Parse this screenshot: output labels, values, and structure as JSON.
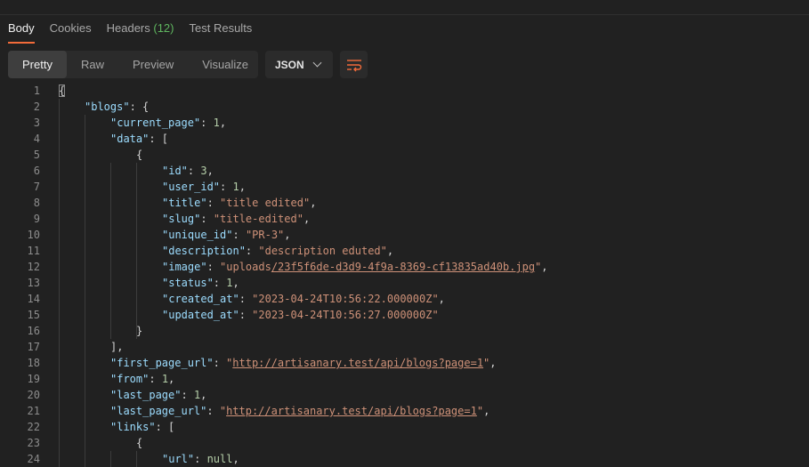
{
  "tabs": [
    {
      "label": "Body"
    },
    {
      "label": "Cookies"
    },
    {
      "label": "Headers",
      "count": "(12)"
    },
    {
      "label": "Test Results"
    }
  ],
  "view_modes": [
    "Pretty",
    "Raw",
    "Preview",
    "Visualize"
  ],
  "format": "JSON",
  "icons": {
    "format_chevron": "chevron-down-icon",
    "wrap": "wrap-lines-icon"
  },
  "colors": {
    "accent": "#f26b3a",
    "key": "#9cdcfe",
    "string": "#ce9178",
    "number": "#b5cea8",
    "count": "#5fb55f"
  },
  "code": {
    "lines": [
      {
        "n": "1",
        "indent": 0,
        "parts": [
          {
            "t": "p",
            "v": "{"
          }
        ]
      },
      {
        "n": "2",
        "indent": 1,
        "parts": [
          {
            "t": "k",
            "v": "\"blogs\""
          },
          {
            "t": "p",
            "v": ": {"
          }
        ]
      },
      {
        "n": "3",
        "indent": 2,
        "parts": [
          {
            "t": "k",
            "v": "\"current_page\""
          },
          {
            "t": "p",
            "v": ": "
          },
          {
            "t": "n",
            "v": "1"
          },
          {
            "t": "p",
            "v": ","
          }
        ]
      },
      {
        "n": "4",
        "indent": 2,
        "parts": [
          {
            "t": "k",
            "v": "\"data\""
          },
          {
            "t": "p",
            "v": ": ["
          }
        ]
      },
      {
        "n": "5",
        "indent": 3,
        "parts": [
          {
            "t": "p",
            "v": "{"
          }
        ]
      },
      {
        "n": "6",
        "indent": 4,
        "parts": [
          {
            "t": "k",
            "v": "\"id\""
          },
          {
            "t": "p",
            "v": ": "
          },
          {
            "t": "n",
            "v": "3"
          },
          {
            "t": "p",
            "v": ","
          }
        ]
      },
      {
        "n": "7",
        "indent": 4,
        "parts": [
          {
            "t": "k",
            "v": "\"user_id\""
          },
          {
            "t": "p",
            "v": ": "
          },
          {
            "t": "n",
            "v": "1"
          },
          {
            "t": "p",
            "v": ","
          }
        ]
      },
      {
        "n": "8",
        "indent": 4,
        "parts": [
          {
            "t": "k",
            "v": "\"title\""
          },
          {
            "t": "p",
            "v": ": "
          },
          {
            "t": "s",
            "v": "\"title edited\""
          },
          {
            "t": "p",
            "v": ","
          }
        ]
      },
      {
        "n": "9",
        "indent": 4,
        "parts": [
          {
            "t": "k",
            "v": "\"slug\""
          },
          {
            "t": "p",
            "v": ": "
          },
          {
            "t": "s",
            "v": "\"title-edited\""
          },
          {
            "t": "p",
            "v": ","
          }
        ]
      },
      {
        "n": "10",
        "indent": 4,
        "parts": [
          {
            "t": "k",
            "v": "\"unique_id\""
          },
          {
            "t": "p",
            "v": ": "
          },
          {
            "t": "s",
            "v": "\"PR-3\""
          },
          {
            "t": "p",
            "v": ","
          }
        ]
      },
      {
        "n": "11",
        "indent": 4,
        "parts": [
          {
            "t": "k",
            "v": "\"description\""
          },
          {
            "t": "p",
            "v": ": "
          },
          {
            "t": "s",
            "v": "\"description eduted\""
          },
          {
            "t": "p",
            "v": ","
          }
        ]
      },
      {
        "n": "12",
        "indent": 4,
        "parts": [
          {
            "t": "k",
            "v": "\"image\""
          },
          {
            "t": "p",
            "v": ": "
          },
          {
            "t": "s",
            "v": "\"uploads"
          },
          {
            "t": "u",
            "v": "/23f5f6de-d3d9-4f9a-8369-cf13835ad40b.jpg"
          },
          {
            "t": "s",
            "v": "\""
          },
          {
            "t": "p",
            "v": ","
          }
        ]
      },
      {
        "n": "13",
        "indent": 4,
        "parts": [
          {
            "t": "k",
            "v": "\"status\""
          },
          {
            "t": "p",
            "v": ": "
          },
          {
            "t": "n",
            "v": "1"
          },
          {
            "t": "p",
            "v": ","
          }
        ]
      },
      {
        "n": "14",
        "indent": 4,
        "parts": [
          {
            "t": "k",
            "v": "\"created_at\""
          },
          {
            "t": "p",
            "v": ": "
          },
          {
            "t": "s",
            "v": "\"2023-04-24T10:56:22.000000Z\""
          },
          {
            "t": "p",
            "v": ","
          }
        ]
      },
      {
        "n": "15",
        "indent": 4,
        "parts": [
          {
            "t": "k",
            "v": "\"updated_at\""
          },
          {
            "t": "p",
            "v": ": "
          },
          {
            "t": "s",
            "v": "\"2023-04-24T10:56:27.000000Z\""
          }
        ]
      },
      {
        "n": "16",
        "indent": 3,
        "parts": [
          {
            "t": "p",
            "v": "}"
          }
        ]
      },
      {
        "n": "17",
        "indent": 2,
        "parts": [
          {
            "t": "p",
            "v": "],"
          }
        ]
      },
      {
        "n": "18",
        "indent": 2,
        "parts": [
          {
            "t": "k",
            "v": "\"first_page_url\""
          },
          {
            "t": "p",
            "v": ": "
          },
          {
            "t": "s",
            "v": "\""
          },
          {
            "t": "u",
            "v": "http://artisanary.test/api/blogs?page=1"
          },
          {
            "t": "s",
            "v": "\""
          },
          {
            "t": "p",
            "v": ","
          }
        ]
      },
      {
        "n": "19",
        "indent": 2,
        "parts": [
          {
            "t": "k",
            "v": "\"from\""
          },
          {
            "t": "p",
            "v": ": "
          },
          {
            "t": "n",
            "v": "1"
          },
          {
            "t": "p",
            "v": ","
          }
        ]
      },
      {
        "n": "20",
        "indent": 2,
        "parts": [
          {
            "t": "k",
            "v": "\"last_page\""
          },
          {
            "t": "p",
            "v": ": "
          },
          {
            "t": "n",
            "v": "1"
          },
          {
            "t": "p",
            "v": ","
          }
        ]
      },
      {
        "n": "21",
        "indent": 2,
        "parts": [
          {
            "t": "k",
            "v": "\"last_page_url\""
          },
          {
            "t": "p",
            "v": ": "
          },
          {
            "t": "s",
            "v": "\""
          },
          {
            "t": "u",
            "v": "http://artisanary.test/api/blogs?page=1"
          },
          {
            "t": "s",
            "v": "\""
          },
          {
            "t": "p",
            "v": ","
          }
        ]
      },
      {
        "n": "22",
        "indent": 2,
        "parts": [
          {
            "t": "k",
            "v": "\"links\""
          },
          {
            "t": "p",
            "v": ": ["
          }
        ]
      },
      {
        "n": "23",
        "indent": 3,
        "parts": [
          {
            "t": "p",
            "v": "{"
          }
        ]
      },
      {
        "n": "24",
        "indent": 4,
        "parts": [
          {
            "t": "k",
            "v": "\"url\""
          },
          {
            "t": "p",
            "v": ": "
          },
          {
            "t": "n",
            "v": "null"
          },
          {
            "t": "p",
            "v": ","
          }
        ]
      }
    ]
  }
}
